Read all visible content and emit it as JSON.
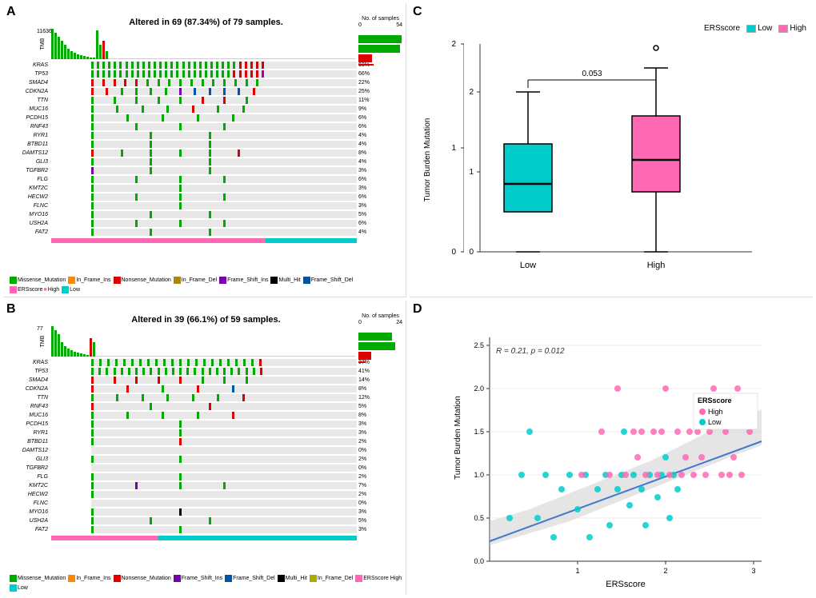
{
  "panels": {
    "A": {
      "label": "A",
      "title": "Altered in 69 (87.34%) of 79 samples.",
      "tmb_max": "11636",
      "samples_max": "54",
      "erscore_bar_color": "#FF69B4",
      "genes": [
        {
          "name": "KRAS",
          "pct": "68%",
          "colors": [
            "#00aa00",
            "#00aa00",
            "#00aa00",
            "#00aa00",
            "#00aa00",
            "#00aa00",
            "#00aa00",
            "#00aa00",
            "#00aa00",
            "#00aa00",
            "#00aa00",
            "#00aa00",
            "#00aa00",
            "#00aa00",
            "#00aa00",
            "#00aa00",
            "#00aa00",
            "#00aa00",
            "#00aa00",
            "#00aa00",
            "#00aa00",
            "#00aa00",
            "#00aa00",
            "#00aa00",
            "#00aa00",
            "#00aa00",
            "#dd0000",
            "#dd0000",
            "#dd0000",
            "#dd0000",
            "#dd0000"
          ]
        },
        {
          "name": "TP53",
          "pct": "66%",
          "colors": [
            "#00aa00",
            "#00aa00",
            "#00aa00",
            "#00aa00",
            "#00aa00",
            "#00aa00",
            "#00aa00",
            "#00aa00",
            "#00aa00",
            "#00aa00",
            "#00aa00",
            "#00aa00",
            "#00aa00",
            "#00aa00",
            "#00aa00",
            "#00aa00",
            "#00aa00",
            "#00aa00",
            "#00aa00",
            "#00aa00",
            "#00aa00",
            "#00aa00",
            "#00aa00",
            "#00aa00",
            "#00aa00",
            "#dd0000",
            "#dd0000",
            "#dd0000",
            "#dd0000",
            "#dd0000",
            "#aa00aa"
          ]
        },
        {
          "name": "SMAD4",
          "pct": "22%",
          "colors": [
            "#dd0000",
            "#dd0000",
            "#dd0000",
            "#dd0000",
            "#dd0000",
            "#00aa00",
            "#00aa00",
            "#00aa00",
            "#00aa00",
            "#00aa00",
            "#00aa00",
            "#00aa00",
            "#00aa00",
            "#00aa00",
            "#00aa00",
            "#00aa00"
          ]
        },
        {
          "name": "CDKN2A",
          "pct": "25%",
          "colors": [
            "#dd0000",
            "#dd0000",
            "#00aa00",
            "#00aa00",
            "#00aa00",
            "#00aa00",
            "#7700aa",
            "#0055aa",
            "#0055aa",
            "#0055aa",
            "#0055aa",
            "#dd0000"
          ]
        },
        {
          "name": "TTN",
          "pct": "11%",
          "colors": [
            "#00aa00",
            "#00aa00",
            "#00aa00",
            "#00aa00",
            "#00aa00",
            "#dd0000",
            "#dd0000",
            "#00aa00"
          ]
        },
        {
          "name": "MUC16",
          "pct": "9%",
          "colors": [
            "#00aa00",
            "#00aa00",
            "#00aa00",
            "#00aa00",
            "#dd0000",
            "#00aa00",
            "#00aa00"
          ]
        },
        {
          "name": "PCDH15",
          "pct": "6%",
          "colors": [
            "#00aa00",
            "#00aa00",
            "#00aa00",
            "#00aa00",
            "#00aa00"
          ]
        },
        {
          "name": "RNF43",
          "pct": "6%",
          "colors": [
            "#00aa00",
            "#00aa00",
            "#00aa00",
            "#00aa00"
          ]
        },
        {
          "name": "RYR1",
          "pct": "4%",
          "colors": [
            "#00aa00",
            "#00aa00",
            "#00aa00"
          ]
        },
        {
          "name": "BTBD11",
          "pct": "4%",
          "colors": [
            "#00aa00",
            "#00aa00",
            "#00aa00"
          ]
        },
        {
          "name": "DAMTS12",
          "pct": "8%",
          "colors": [
            "#dd0000",
            "#00aa00",
            "#00aa00",
            "#00aa00",
            "#00aa00",
            "#dd0000"
          ]
        },
        {
          "name": "GLI3",
          "pct": "4%",
          "colors": [
            "#00aa00",
            "#00aa00",
            "#00aa00"
          ]
        },
        {
          "name": "TGFBR2",
          "pct": "3%",
          "colors": [
            "#7700aa",
            "#00aa00",
            "#00aa00"
          ]
        },
        {
          "name": "FLG",
          "pct": "6%",
          "colors": [
            "#00aa00",
            "#00aa00",
            "#00aa00",
            "#00aa00"
          ]
        },
        {
          "name": "KMT2C",
          "pct": "3%",
          "colors": [
            "#00aa00",
            "#00aa00"
          ]
        },
        {
          "name": "HECW2",
          "pct": "6%",
          "colors": [
            "#00aa00",
            "#00aa00",
            "#00aa00",
            "#00aa00"
          ]
        },
        {
          "name": "FLNC",
          "pct": "3%",
          "colors": [
            "#00aa00",
            "#00aa00"
          ]
        },
        {
          "name": "MYO16",
          "pct": "5%",
          "colors": [
            "#00aa00",
            "#00aa00",
            "#00aa00"
          ]
        },
        {
          "name": "USH2A",
          "pct": "6%",
          "colors": [
            "#00aa00",
            "#00aa00",
            "#00aa00",
            "#00aa00"
          ]
        },
        {
          "name": "FAT2",
          "pct": "4%",
          "colors": [
            "#00aa00",
            "#00aa00",
            "#00aa00"
          ]
        }
      ]
    },
    "B": {
      "label": "B",
      "title": "Altered in 39 (66.1%) of 59 samples.",
      "tmb_max": "77",
      "samples_max": "24",
      "erscore_bar_color": "#00cccc",
      "genes": [
        {
          "name": "KRAS",
          "pct": "37%",
          "colors": [
            "#00aa00",
            "#00aa00",
            "#00aa00",
            "#00aa00",
            "#00aa00",
            "#00aa00",
            "#00aa00",
            "#00aa00",
            "#00aa00",
            "#00aa00",
            "#00aa00",
            "#00aa00",
            "#00aa00",
            "#00aa00",
            "#00aa00",
            "#00aa00",
            "#00aa00",
            "#00aa00",
            "#00aa00",
            "#00aa00",
            "#00aa00",
            "#dd0000"
          ]
        },
        {
          "name": "TP53",
          "pct": "41%",
          "colors": [
            "#00aa00",
            "#00aa00",
            "#00aa00",
            "#00aa00",
            "#00aa00",
            "#00aa00",
            "#00aa00",
            "#00aa00",
            "#00aa00",
            "#00aa00",
            "#00aa00",
            "#00aa00",
            "#00aa00",
            "#00aa00",
            "#00aa00",
            "#00aa00",
            "#00aa00",
            "#00aa00",
            "#00aa00",
            "#00aa00",
            "#00aa00",
            "#00aa00",
            "#00aa00",
            "#dd0000"
          ]
        },
        {
          "name": "SMAD4",
          "pct": "14%",
          "colors": [
            "#dd0000",
            "#dd0000",
            "#dd0000",
            "#dd0000",
            "#dd0000",
            "#00aa00",
            "#00aa00",
            "#00aa00"
          ]
        },
        {
          "name": "CDKN2A",
          "pct": "8%",
          "colors": [
            "#dd0000",
            "#dd0000",
            "#00aa00",
            "#dd0000",
            "#0055aa"
          ]
        },
        {
          "name": "TTN",
          "pct": "12%",
          "colors": [
            "#00aa00",
            "#00aa00",
            "#00aa00",
            "#00aa00",
            "#00aa00",
            "#00aa00",
            "#dd0000"
          ]
        },
        {
          "name": "RNF43",
          "pct": "5%",
          "colors": [
            "#dd0000",
            "#00aa00",
            "#dd0000"
          ]
        },
        {
          "name": "MUC16",
          "pct": "8%",
          "colors": [
            "#00aa00",
            "#00aa00",
            "#00aa00",
            "#00aa00",
            "#dd0000"
          ]
        },
        {
          "name": "PCDH15",
          "pct": "3%",
          "colors": [
            "#00aa00",
            "#00aa00"
          ]
        },
        {
          "name": "RYR1",
          "pct": "3%",
          "colors": [
            "#00aa00",
            "#00aa00"
          ]
        },
        {
          "name": "BTBD11",
          "pct": "2%",
          "colors": [
            "#00aa00",
            "#dd0000"
          ]
        },
        {
          "name": "DAMTS12",
          "pct": "0%",
          "colors": []
        },
        {
          "name": "GLI3",
          "pct": "2%",
          "colors": [
            "#00aa00",
            "#00aa00"
          ]
        },
        {
          "name": "TGFBR2",
          "pct": "0%",
          "colors": []
        },
        {
          "name": "FLG",
          "pct": "2%",
          "colors": [
            "#00aa00",
            "#00aa00"
          ]
        },
        {
          "name": "KMT2C",
          "pct": "7%",
          "colors": [
            "#00aa00",
            "#7700aa",
            "#00aa00",
            "#00aa00"
          ]
        },
        {
          "name": "HECW2",
          "pct": "2%",
          "colors": [
            "#00aa00"
          ]
        },
        {
          "name": "FLNC",
          "pct": "0%",
          "colors": []
        },
        {
          "name": "MYO16",
          "pct": "3%",
          "colors": [
            "#00aa00",
            "#000000"
          ]
        },
        {
          "name": "USH2A",
          "pct": "5%",
          "colors": [
            "#00aa00",
            "#00aa00",
            "#00aa00"
          ]
        },
        {
          "name": "FAT2",
          "pct": "3%",
          "colors": [
            "#00aa00",
            "#00aa00"
          ]
        }
      ]
    },
    "C": {
      "label": "C",
      "title": "",
      "legend_low_color": "#00cccc",
      "legend_high_color": "#FF69B4",
      "legend_low_label": "Low",
      "legend_high_label": "High",
      "legend_title": "ERSscore",
      "pvalue": "0.053",
      "y_axis_label": "Tumor Burden Mutation",
      "x_labels": [
        "Low",
        "High"
      ],
      "y_ticks": [
        "0",
        "1",
        "2"
      ]
    },
    "D": {
      "label": "D",
      "title": "",
      "legend_title": "ERSscore",
      "legend_high_label": "High",
      "legend_low_label": "Low",
      "legend_high_color": "#FF69B4",
      "legend_low_color": "#00cccc",
      "annotation": "R = 0.21, p = 0.012",
      "x_axis_label": "ERSscore",
      "y_axis_label": "Tumor Burden Mutation",
      "x_ticks": [
        "1",
        "2",
        "3"
      ],
      "y_ticks": [
        "0.0",
        "0.5",
        "1.0",
        "1.5",
        "2.0",
        "2.5"
      ]
    }
  },
  "colors": {
    "missense": "#00aa00",
    "nonsense": "#dd0000",
    "frame_shift_ins": "#7700aa",
    "frame_shift_del": "#0055aa",
    "in_frame_ins": "#ff8800",
    "in_frame_del": "#aa8800",
    "multi_hit": "#000000",
    "ers_high": "#FF69B4",
    "ers_low": "#00cccc"
  },
  "legend_A": {
    "items": [
      {
        "label": "Missense_Mutation",
        "color": "#00aa00"
      },
      {
        "label": "In_Frame_Ins",
        "color": "#ff8800"
      },
      {
        "label": "Nonsense_Mutation",
        "color": "#dd0000"
      },
      {
        "label": "In_Frame_Del",
        "color": "#aa8800"
      },
      {
        "label": "Frame_Shift_Ins",
        "color": "#7700aa"
      },
      {
        "label": "Multi_Hit",
        "color": "#000000"
      },
      {
        "label": "Frame_Shift_Del",
        "color": "#0055aa"
      },
      {
        "label": "ERSscore High",
        "color": "#FF69B4"
      },
      {
        "label": "ERSscore Low",
        "color": "#00cccc"
      }
    ]
  },
  "legend_B": {
    "items": [
      {
        "label": "Missense_Mutation",
        "color": "#00aa00"
      },
      {
        "label": "In_Frame_Ins",
        "color": "#ff8800"
      },
      {
        "label": "Nonsense_Mutation",
        "color": "#dd0000"
      },
      {
        "label": "Frame_Shift_Ins",
        "color": "#7700aa"
      },
      {
        "label": "Frame_Shift_Del",
        "color": "#0055aa"
      },
      {
        "label": "Multi_Hit",
        "color": "#000000"
      },
      {
        "label": "In_Frame_Del",
        "color": "#aaaa00"
      },
      {
        "label": "ERSscore High",
        "color": "#FF69B4"
      },
      {
        "label": "ERSscore Low",
        "color": "#00cccc"
      }
    ]
  }
}
